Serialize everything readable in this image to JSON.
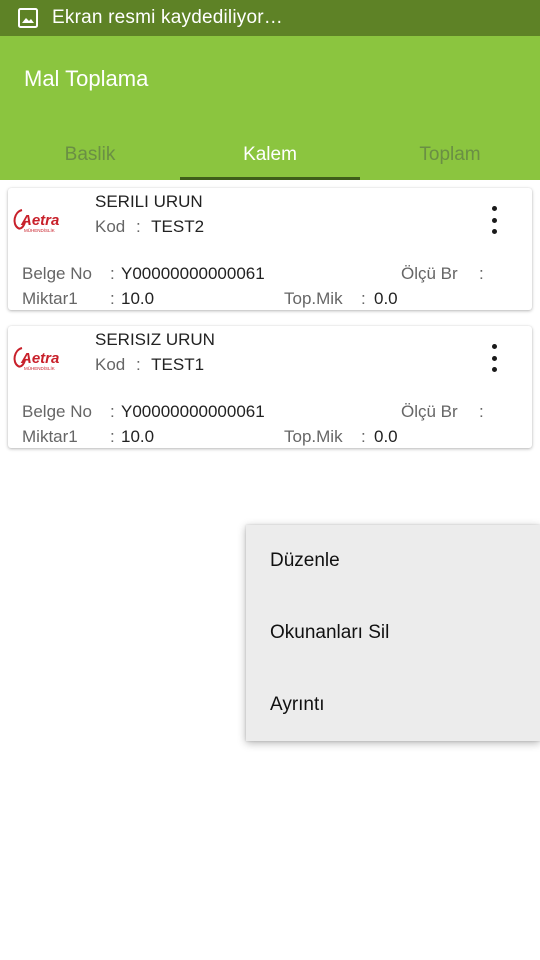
{
  "status_bar": {
    "text": "Ekran resmi kaydediliyor…",
    "icon": "image-icon"
  },
  "app_bar": {
    "title": "Mal Toplama",
    "color": "#8bc53f",
    "tabs": [
      {
        "label": "Baslik",
        "active": false
      },
      {
        "label": "Kalem",
        "active": true
      },
      {
        "label": "Toplam",
        "active": false
      }
    ]
  },
  "items": [
    {
      "logo_text": "Aetra",
      "logo_sub": "MÜHENDİSLİK",
      "title": "SERILI URUN",
      "kod_label": "Kod",
      "kod_value": "TEST2",
      "belge_label": "Belge No",
      "belge_value": "Y00000000000061",
      "olcu_label": "Ölçü Br",
      "olcu_value": "",
      "miktar_label": "Miktar1",
      "miktar_value": "10.0",
      "topmik_label": "Top.Mik",
      "topmik_value": "0.0"
    },
    {
      "logo_text": "Aetra",
      "logo_sub": "MÜHENDİSLİK",
      "title": "SERISIZ URUN",
      "kod_label": "Kod",
      "kod_value": "TEST1",
      "belge_label": "Belge No",
      "belge_value": "Y00000000000061",
      "olcu_label": "Ölçü Br",
      "olcu_value": "",
      "miktar_label": "Miktar1",
      "miktar_value": "10.0",
      "topmik_label": "Top.Mik",
      "topmik_value": "0.0"
    }
  ],
  "context_menu": {
    "items": [
      "Düzenle",
      "Okunanları Sil",
      "Ayrıntı"
    ]
  },
  "colon": ":"
}
